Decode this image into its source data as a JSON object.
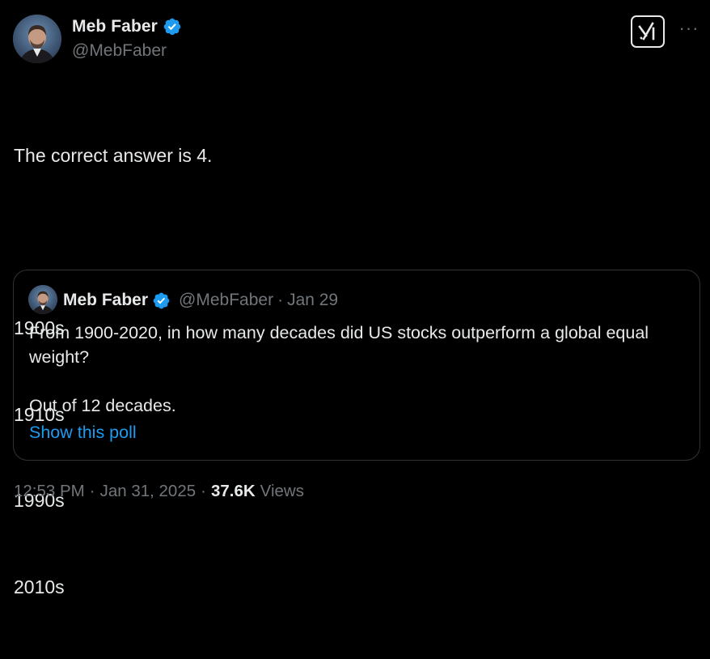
{
  "author": {
    "display_name": "Meb Faber",
    "handle": "@MebFaber",
    "verified": true,
    "avatar_icon": "profile-photo"
  },
  "actions": {
    "grok_icon": "grok-icon",
    "more_icon": "more-horizontal-icon",
    "more_label": "···"
  },
  "tweet": {
    "lines": [
      "The correct answer is 4.",
      "",
      "1900s",
      "1910s",
      "1990s",
      "2010s"
    ]
  },
  "quote": {
    "display_name": "Meb Faber",
    "handle": "@MebFaber",
    "separator": "·",
    "date": "Jan 29",
    "text_line1": "From 1900-2020, in how many decades did US stocks outperform a global equal weight?",
    "text_line2": "Out of 12 decades.",
    "link_label": "Show this poll"
  },
  "meta": {
    "time": "12:53 PM",
    "sep1": "·",
    "date": "Jan 31, 2025",
    "sep2": "·",
    "views_count": "37.6K",
    "views_label": "Views"
  },
  "colors": {
    "background": "#000000",
    "text_primary": "#e7e9ea",
    "text_secondary": "#71767b",
    "link": "#1d9bf0",
    "verified_badge": "#1d9bf0",
    "border": "#2f3336"
  }
}
